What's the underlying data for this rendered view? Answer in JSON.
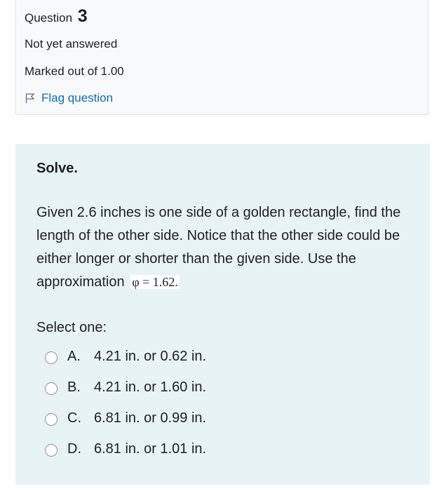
{
  "question_info": {
    "label": "Question",
    "number": "3",
    "state": "Not yet answered",
    "grade": "Marked out of 1.00",
    "flag_label": "Flag question",
    "flag_icon": "flag-outline-icon"
  },
  "question": {
    "title": "Solve.",
    "text": "Given 2.6 inches is one side of a golden rectangle, find the length of the other side. Notice that the other side could be either longer or shorter than the given side. Use the approximation",
    "formula": "φ = 1.62.",
    "prompt": "Select one:"
  },
  "answers": [
    {
      "letter": "A.",
      "text": "4.21 in. or 0.62 in."
    },
    {
      "letter": "B.",
      "text": "4.21 in. or 1.60 in."
    },
    {
      "letter": "C.",
      "text": "6.81 in. or 0.99 in."
    },
    {
      "letter": "D.",
      "text": "6.81 in. or 1.01 in."
    }
  ],
  "colors": {
    "info_background": "#f8f9fa",
    "content_background": "#e7f3f5",
    "link": "#0f6cbf",
    "text": "#1d2125"
  }
}
